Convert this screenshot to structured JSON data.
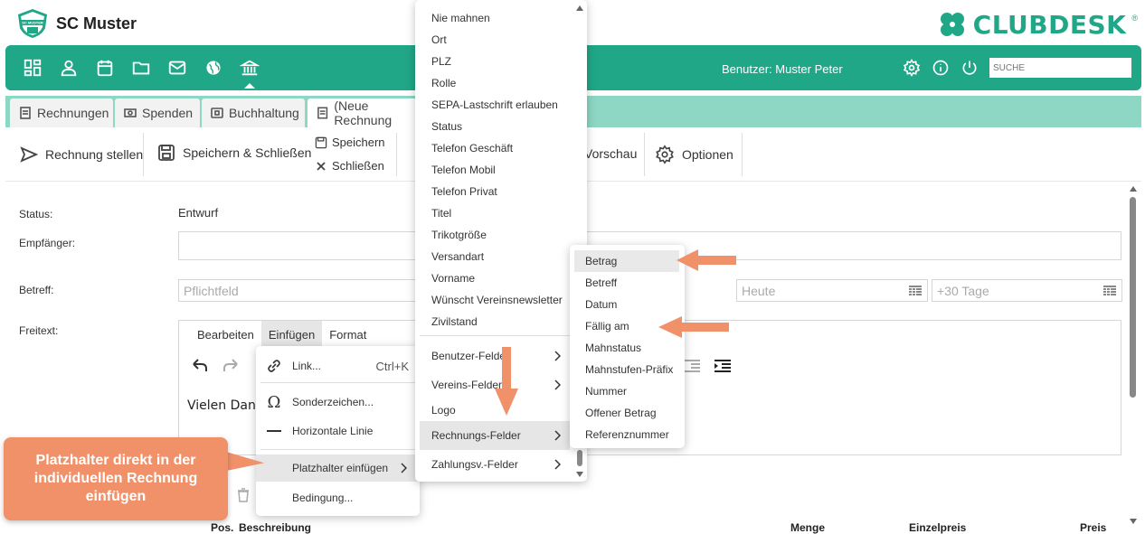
{
  "header": {
    "club_name": "SC Muster",
    "club_badge": "SC MUSTER",
    "brand": "CLUBDESK",
    "brand_reg": "®"
  },
  "nav": {
    "icons": [
      "dashboard-icon",
      "user-icon",
      "calendar-icon",
      "folder-icon",
      "mail-icon",
      "globe-icon",
      "bank-icon"
    ],
    "user_label": "Benutzer: Muster Peter",
    "search_placeholder": "SUCHE"
  },
  "tabs": [
    {
      "label": "Rechnungen",
      "icon": "invoice-icon"
    },
    {
      "label": "Spenden",
      "icon": "money-icon"
    },
    {
      "label": "Buchhaltung",
      "icon": "ledger-icon"
    },
    {
      "label": "(Neue Rechnung",
      "icon": "invoice-icon"
    }
  ],
  "toolbar": {
    "send": "Rechnung stellen",
    "save_close": "Speichern & Schließen",
    "save": "Speichern",
    "close": "Schließen",
    "preview": "Vorschau",
    "options": "Optionen"
  },
  "form": {
    "status_label": "Status:",
    "status_value": "Entwurf",
    "recipient_label": "Empfänger:",
    "subject_label": "Betreff:",
    "subject_placeholder": "Pflichtfeld",
    "date_placeholder": "Heute",
    "due_placeholder": "+30 Tage",
    "freetext_label": "Freitext:"
  },
  "editor": {
    "menu": [
      "Bearbeiten",
      "Einfügen",
      "Format"
    ],
    "text": "Vielen Dank"
  },
  "insert_menu": {
    "items": [
      {
        "label": "Link...",
        "shortcut": "Ctrl+K",
        "icon": "link-icon"
      },
      {
        "label": "Sonderzeichen...",
        "icon": "omega-icon"
      },
      {
        "label": "Horizontale Linie",
        "icon": "hr-icon"
      },
      {
        "label": "Platzhalter einfügen",
        "icon": ""
      },
      {
        "label": "Bedingung...",
        "icon": ""
      }
    ]
  },
  "field_list": {
    "items": [
      "Nie mahnen",
      "Ort",
      "PLZ",
      "Rolle",
      "SEPA-Lastschrift erlauben",
      "Status",
      "Telefon Geschäft",
      "Telefon Mobil",
      "Telefon Privat",
      "Titel",
      "Trikotgröße",
      "Versandart",
      "Vorname",
      "Wünscht Vereinsnewsletter",
      "Zivilstand"
    ],
    "submenus": [
      "Benutzer-Felder",
      "Vereins-Felder",
      "Logo",
      "Rechnungs-Felder",
      "Zahlungsv.-Felder"
    ]
  },
  "invoice_fields": [
    "Betrag",
    "Betreff",
    "Datum",
    "Fällig am",
    "Mahnstatus",
    "Mahnstufen-Präfix",
    "Nummer",
    "Offener Betrag",
    "Referenznummer"
  ],
  "callout": "Platzhalter direkt in der individuellen Rechnung einfügen",
  "table_header": {
    "pos": "Pos.",
    "desc": "Beschreibung",
    "qty": "Menge",
    "unit": "Einzelpreis",
    "price": "Preis"
  },
  "colors": {
    "brand": "#20a787",
    "tabbar": "#8dd7c4",
    "callout": "#f0916a"
  }
}
